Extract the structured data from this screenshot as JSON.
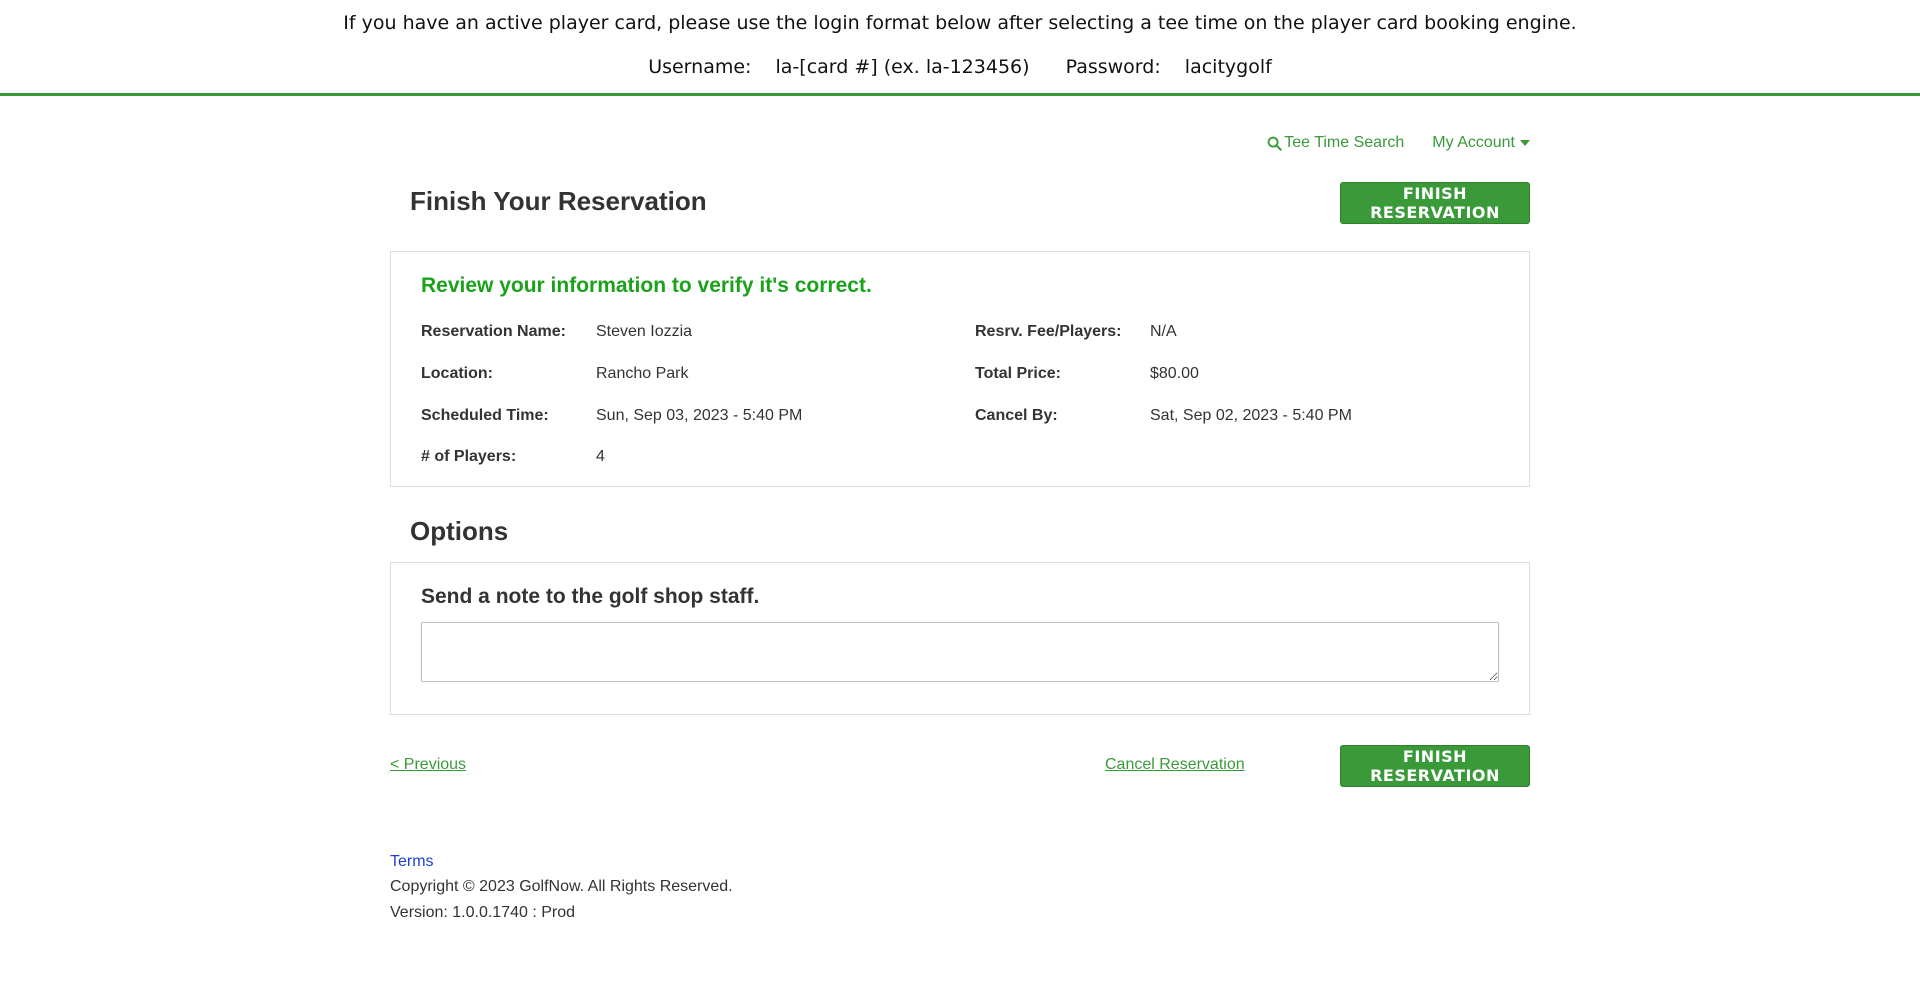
{
  "banner": {
    "line1": "If you have an active player card, please use the login format below after selecting a tee time on the player card booking engine.",
    "username_label": "Username:",
    "username_value": "la-[card #] (ex. la-123456)",
    "password_label": "Password:",
    "password_value": "lacitygolf",
    "border_color": "#3a9a3a"
  },
  "nav": {
    "tee_time_search": "Tee Time Search",
    "my_account": "My Account",
    "search_icon": "search-icon",
    "dropdown_icon": "caret-down-icon"
  },
  "page": {
    "title": "Finish Your Reservation",
    "finish_button": "FINISH RESERVATION"
  },
  "review": {
    "heading": "Review your information to verify it's correct.",
    "fields": [
      {
        "label": "Reservation Name:",
        "value": "Steven Iozzia"
      },
      {
        "label": "Location:",
        "value": "Rancho Park"
      },
      {
        "label": "Scheduled Time:",
        "value": "Sun, Sep 03, 2023 - 5:40 PM"
      },
      {
        "label": "# of Players:",
        "value": "4"
      },
      {
        "label": "Resrv. Fee/Players:",
        "value": "N/A"
      },
      {
        "label": "Total Price:",
        "value": "$80.00"
      },
      {
        "label": "Cancel By:",
        "value": "Sat, Sep 02, 2023 - 5:40 PM"
      }
    ]
  },
  "options": {
    "title": "Options",
    "note_heading": "Send a note to the golf shop staff.",
    "note_value": ""
  },
  "actions": {
    "previous": "< Previous",
    "cancel": "Cancel Reservation",
    "finish": "FINISH RESERVATION"
  },
  "footer": {
    "terms": "Terms",
    "copyright": "Copyright © 2023 GolfNow. All Rights Reserved.",
    "version": "Version: 1.0.0.1740 : Prod"
  },
  "colors": {
    "accent_green": "#3a9a3a",
    "heading_green": "#1aa31a",
    "link_blue": "#1a3fd0"
  }
}
